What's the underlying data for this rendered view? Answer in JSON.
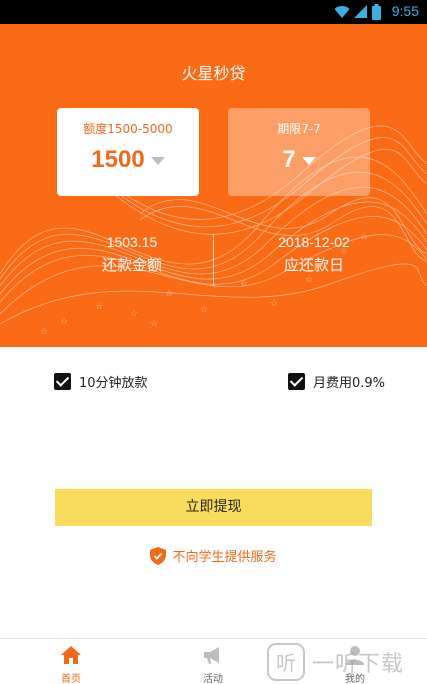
{
  "status_bar": {
    "time": "9:55"
  },
  "header": {
    "title": "火星秒贷"
  },
  "amount_card": {
    "label": "额度1500-5000",
    "value": "1500"
  },
  "term_card": {
    "label": "期限7-7",
    "value": "7"
  },
  "stats": {
    "repay_amount": {
      "value": "1503.15",
      "label": "还款金额"
    },
    "due_date": {
      "value": "2018-12-02",
      "label": "应还款日"
    }
  },
  "options": [
    {
      "label": "10分钟放款",
      "checked": true
    },
    {
      "label": "月费用0.9%",
      "checked": true
    }
  ],
  "cta": {
    "label": "立即提现"
  },
  "notice": {
    "text": "不向学生提供服务"
  },
  "tabs": [
    {
      "label": "首页",
      "icon": "home-icon",
      "active": true
    },
    {
      "label": "活动",
      "icon": "megaphone-icon",
      "active": false
    },
    {
      "label": "我的",
      "icon": "person-icon",
      "active": false
    }
  ],
  "watermark": {
    "text": "一听下载",
    "icon": "听"
  },
  "colors": {
    "accent": "#fb6a14",
    "cta": "#f9dc5c",
    "text_orange": "#f06a1c"
  }
}
